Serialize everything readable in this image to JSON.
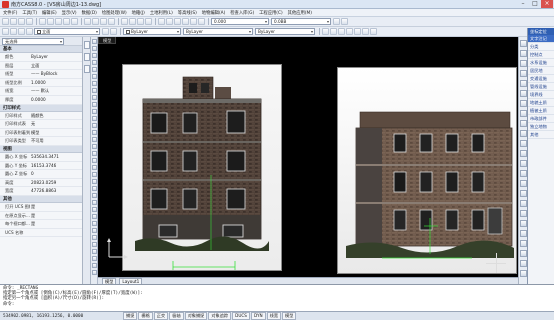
{
  "window": {
    "title": "南方CASS8.0 - [VS房山周边1-13.dwg]"
  },
  "menubar": [
    "文件(F)",
    "工具(T)",
    "编辑(E)",
    "显示(V)",
    "数据(D)",
    "绘图处理(W)",
    "地籍(J)",
    "土地利用(L)",
    "等高线(S)",
    "地物编辑(A)",
    "检查入库(G)",
    "工程应用(C)",
    "其他应用(M)"
  ],
  "toolbar": {
    "layer_value": "立面",
    "style_value": "0.000",
    "linetype_value": "ByLayer",
    "lineweight_value": "ByLayer",
    "color_value": "0.0BB"
  },
  "properties": {
    "selection": "无选择",
    "sections": [
      {
        "title": "基本",
        "rows": [
          {
            "k": "颜色",
            "v": "ByLayer"
          },
          {
            "k": "图层",
            "v": "立面"
          },
          {
            "k": "线型",
            "v": "—— ByBlock"
          },
          {
            "k": "线型比例",
            "v": "1.0000"
          },
          {
            "k": "线宽",
            "v": "—— 默认"
          },
          {
            "k": "厚度",
            "v": "0.0000"
          }
        ]
      },
      {
        "title": "打印样式",
        "rows": [
          {
            "k": "打印样式",
            "v": "随颜色"
          },
          {
            "k": "打印样式表",
            "v": "无"
          },
          {
            "k": "打印表附着到",
            "v": "模型"
          },
          {
            "k": "打印表类型",
            "v": "不可用"
          }
        ]
      },
      {
        "title": "视图",
        "rows": [
          {
            "k": "圆心 X 坐标",
            "v": "535634.3471"
          },
          {
            "k": "圆心 Y 坐标",
            "v": "16153.3746"
          },
          {
            "k": "圆心 Z 坐标",
            "v": "0"
          },
          {
            "k": "高度",
            "v": "20823.0259"
          },
          {
            "k": "宽度",
            "v": "47726.8863"
          }
        ]
      },
      {
        "title": "其他",
        "rows": [
          {
            "k": "打开 UCS 图标",
            "v": "是"
          },
          {
            "k": "在原点显示...",
            "v": "是"
          },
          {
            "k": "每个视口都...",
            "v": "是"
          },
          {
            "k": "UCS 名称",
            "v": ""
          }
        ]
      }
    ]
  },
  "drawing_tab": "模型",
  "layout_tabs": [
    "模型",
    "Layout1"
  ],
  "right_panel": {
    "header": "坐标定位",
    "items": [
      "文字注记",
      "分类",
      "控制点",
      "水系设施",
      "居民地",
      "交通设施",
      "管线设施",
      "境界线",
      "地貌土质",
      "植被土质",
      "市政部件",
      "独立地物",
      "其他"
    ]
  },
  "command_lines": [
    "命令: _RECTANG",
    "指定第一个角点或 [倒角(C)/标高(E)/圆角(F)/厚度(T)/宽度(W)]:",
    "指定另一个角点或 [面积(A)/尺寸(D)/旋转(R)]:",
    "命令:"
  ],
  "status": {
    "coords": "534902.0981, 16193.1256, 0.0000",
    "buttons": [
      "捕捉",
      "栅格",
      "正交",
      "极轴",
      "对象捕捉",
      "对象追踪",
      "DUCS",
      "DYN",
      "线宽",
      "模型"
    ]
  }
}
